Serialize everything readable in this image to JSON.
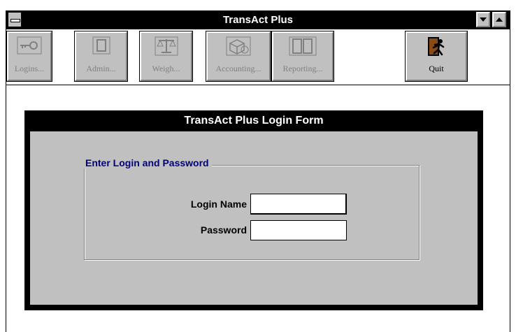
{
  "window": {
    "title": "TransAct Plus"
  },
  "toolbar": {
    "items": [
      {
        "label": "Logins...",
        "icon": "key-icon"
      },
      {
        "label": "Admin...",
        "icon": "door-icon"
      },
      {
        "label": "Weigh...",
        "icon": "scale-icon"
      },
      {
        "label": "Accounting...",
        "icon": "boxes-icon"
      },
      {
        "label": "Reporting...",
        "icon": "report-icon"
      },
      {
        "label": "Quit",
        "icon": "exit-door-icon"
      }
    ]
  },
  "login_form": {
    "title": "TransAct Plus Login Form",
    "group_label": "Enter Login and Password",
    "login_name_label": "Login Name",
    "login_name_value": "",
    "password_label": "Password",
    "password_value": ""
  },
  "colors": {
    "titlebar": "#000000",
    "face": "#c0c0c0",
    "group_label": "#000080"
  }
}
